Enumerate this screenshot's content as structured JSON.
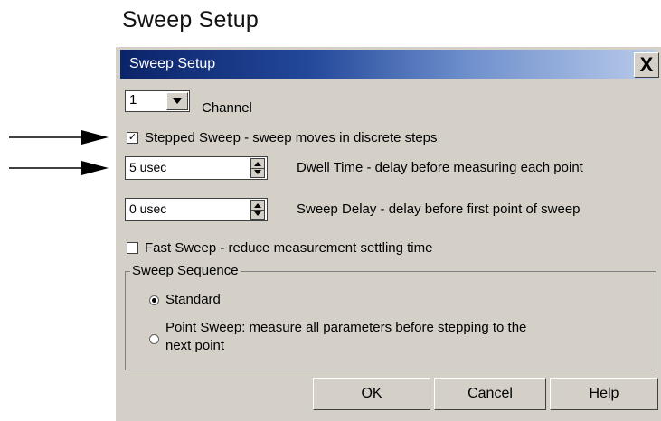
{
  "heading": "Sweep Setup",
  "dialog": {
    "title": "Sweep Setup",
    "close_label": "X"
  },
  "channel": {
    "value": "1",
    "label": "Channel"
  },
  "stepped_sweep": {
    "checked": true,
    "check_mark": "✓",
    "label": "Stepped Sweep - sweep moves in discrete steps"
  },
  "dwell_time": {
    "value": "5 usec",
    "label": "Dwell Time - delay before measuring each point"
  },
  "sweep_delay": {
    "value": "0 usec",
    "label": "Sweep Delay - delay before first point of sweep"
  },
  "fast_sweep": {
    "checked": false,
    "label": "Fast Sweep - reduce measurement settling time"
  },
  "sweep_sequence": {
    "legend": "Sweep Sequence",
    "options": [
      {
        "label": "Standard",
        "selected": true
      },
      {
        "label_line1": "Point Sweep: measure all parameters before stepping to the",
        "label_line2": "next point",
        "selected": false
      }
    ]
  },
  "buttons": {
    "ok": "OK",
    "cancel": "Cancel",
    "help": "Help"
  },
  "colors": {
    "dialog_bg": "#d4d0c8",
    "titlebar_start": "#0a2468",
    "titlebar_end": "#b9cbea"
  }
}
